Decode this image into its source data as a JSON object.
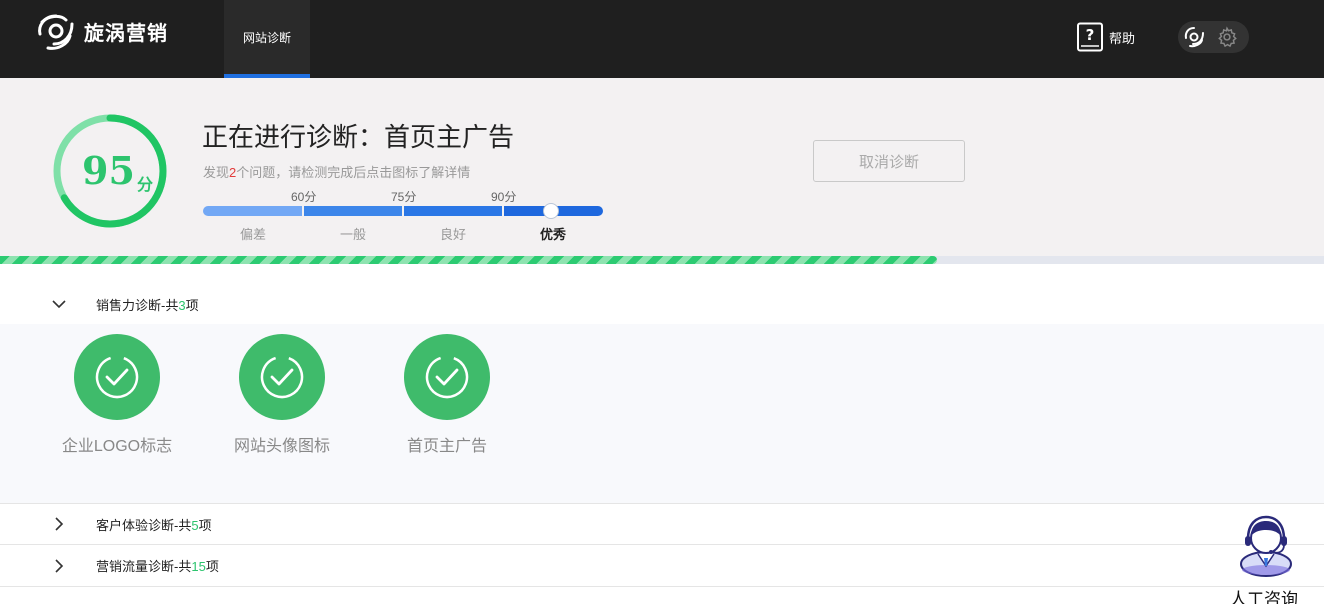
{
  "header": {
    "brand": "旋涡营销",
    "nav_tab": "网站诊断",
    "help_label": "帮助"
  },
  "score": {
    "value": "95",
    "unit": "分",
    "title": "正在进行诊断：首页主广告",
    "subtitle_prefix": "发现",
    "issue_count": "2",
    "subtitle_suffix": "个问题，请检测完成后点击图标了解详情",
    "scale_ticks": [
      "60分",
      "75分",
      "90分"
    ],
    "scale_labels": [
      "偏差",
      "一般",
      "良好",
      "优秀"
    ],
    "active_level": "优秀",
    "cancel_label": "取消诊断"
  },
  "progress": {
    "fraction": 0.708
  },
  "sections": [
    {
      "name_prefix": "销售力诊断-共",
      "count": "3",
      "suffix": "项",
      "expanded": true,
      "items": [
        "企业LOGO标志",
        "网站头像图标",
        "首页主广告"
      ]
    },
    {
      "name_prefix": "客户体验诊断-共",
      "count": "5",
      "suffix": "项",
      "expanded": false
    },
    {
      "name_prefix": "营销流量诊断-共",
      "count": "15",
      "suffix": "项",
      "expanded": false
    }
  ],
  "consult": {
    "label": "人工咨询"
  },
  "colors": {
    "topbar": "#1f1f1f",
    "accent_blue": "#1f6fe0",
    "success_green": "#3fbb6b",
    "score_green": "#2dc46e",
    "issue_red": "#e23b3b"
  }
}
